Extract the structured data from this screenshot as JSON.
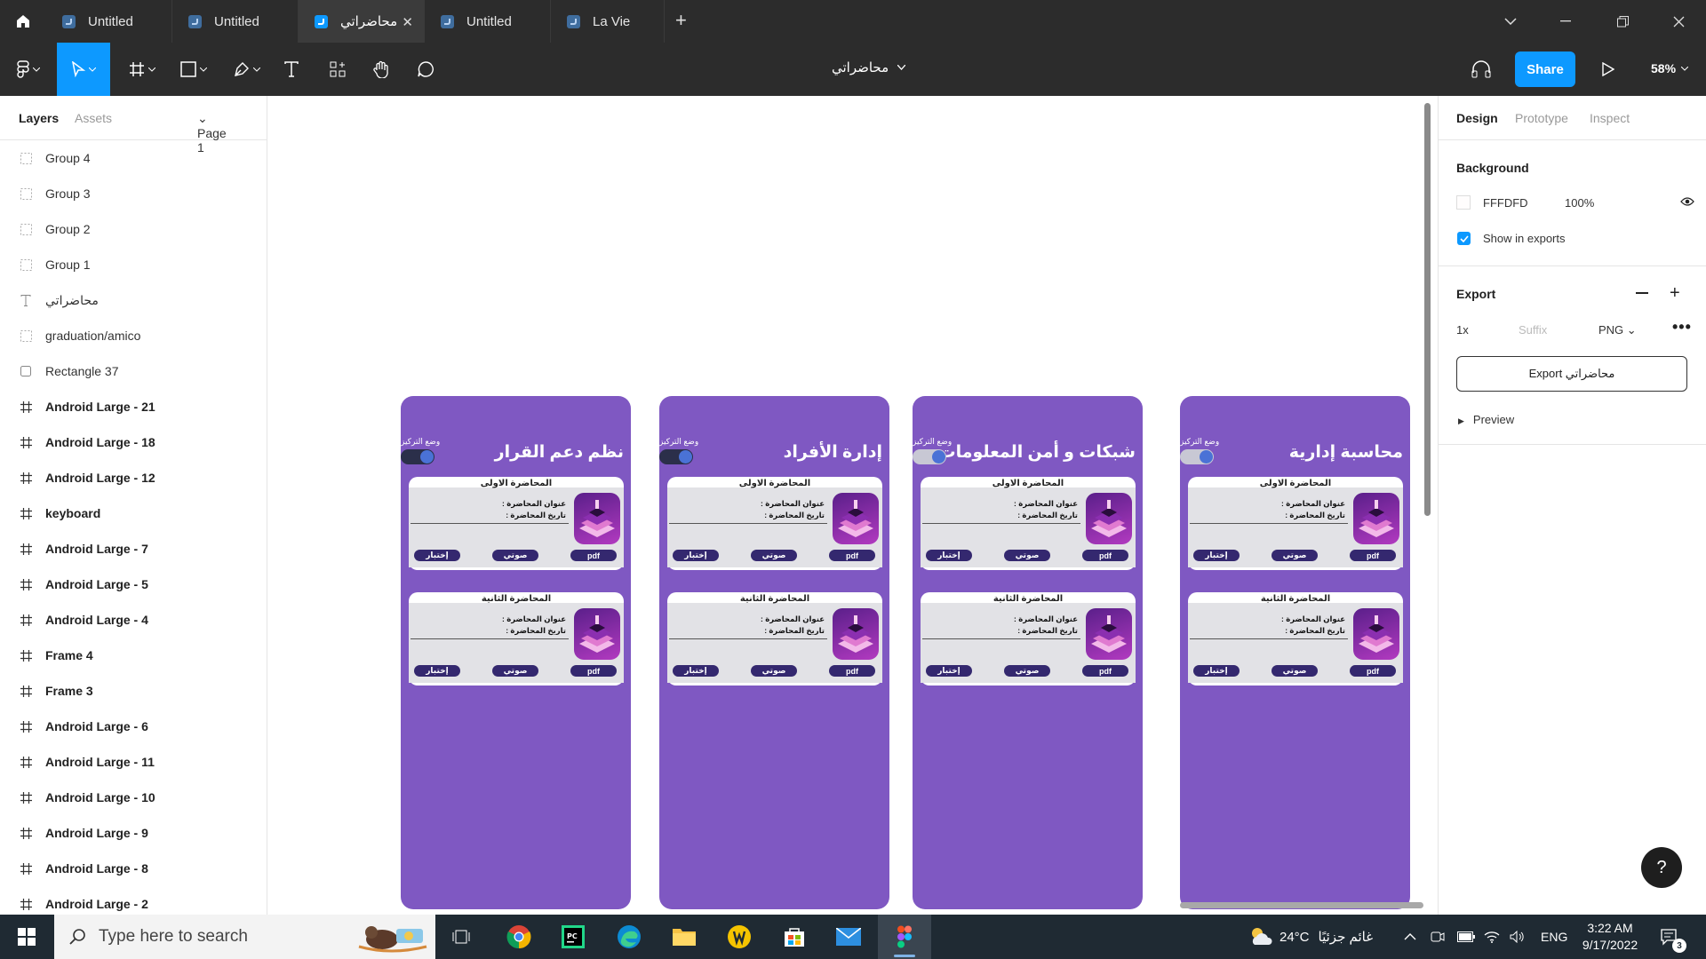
{
  "titlebar": {
    "tabs": [
      {
        "label": "Untitled",
        "active": false
      },
      {
        "label": "Untitled",
        "active": false
      },
      {
        "label": "محاضراتي",
        "active": true
      },
      {
        "label": "Untitled",
        "active": false
      },
      {
        "label": "La Vie",
        "active": false
      }
    ]
  },
  "toolbar": {
    "file_name": "محاضراتي",
    "share_label": "Share",
    "zoom": "58%"
  },
  "left_panel": {
    "tabs": {
      "layers": "Layers",
      "assets": "Assets",
      "page": "Page 1"
    },
    "layers": [
      {
        "name": "Group 4",
        "kind": "group"
      },
      {
        "name": "Group 3",
        "kind": "group"
      },
      {
        "name": "Group 2",
        "kind": "group"
      },
      {
        "name": "Group 1",
        "kind": "group"
      },
      {
        "name": "محاضراتي",
        "kind": "text"
      },
      {
        "name": "graduation/amico",
        "kind": "group"
      },
      {
        "name": "Rectangle 37",
        "kind": "rect"
      },
      {
        "name": "Android Large - 21",
        "kind": "frame"
      },
      {
        "name": "Android Large - 18",
        "kind": "frame"
      },
      {
        "name": "Android Large - 12",
        "kind": "frame"
      },
      {
        "name": "keyboard",
        "kind": "frame"
      },
      {
        "name": "Android Large - 7",
        "kind": "frame"
      },
      {
        "name": "Android Large - 5",
        "kind": "frame"
      },
      {
        "name": "Android Large - 4",
        "kind": "frame"
      },
      {
        "name": "Frame 4",
        "kind": "frame"
      },
      {
        "name": "Frame 3",
        "kind": "frame"
      },
      {
        "name": "Android Large - 6",
        "kind": "frame"
      },
      {
        "name": "Android Large - 11",
        "kind": "frame"
      },
      {
        "name": "Android Large - 10",
        "kind": "frame"
      },
      {
        "name": "Android Large - 9",
        "kind": "frame"
      },
      {
        "name": "Android Large - 8",
        "kind": "frame"
      },
      {
        "name": "Android Large - 2",
        "kind": "frame"
      }
    ]
  },
  "canvas": {
    "focus_label": "وضع التركيز",
    "phones": [
      {
        "title": "نظم دعم القرار",
        "toggle_on": false
      },
      {
        "title": "إدارة الأفراد",
        "toggle_on": false
      },
      {
        "title": "شبكات و أمن المعلومات",
        "toggle_on": true
      },
      {
        "title": "محاسبة إدارية",
        "toggle_on": true
      }
    ],
    "cards": [
      {
        "title": "المحاضرة الاولى"
      },
      {
        "title": "المحاضرة الثانية"
      }
    ],
    "card_line1": "عنوان المحاضرة :",
    "card_line2": "تاريخ المحاضرة :",
    "btn_quiz": "إختبار",
    "btn_audio": "صوتي",
    "btn_pdf": "pdf",
    "colors": {
      "phone_bg": "#7f58c2",
      "button": "#34286f"
    }
  },
  "right_panel": {
    "tabs": {
      "design": "Design",
      "prototype": "Prototype",
      "inspect": "Inspect"
    },
    "background": {
      "title": "Background",
      "hex": "FFFDFD",
      "opacity": "100%",
      "show_in_exports": "Show in exports",
      "checked": true
    },
    "export": {
      "title": "Export",
      "scale": "1x",
      "suffix_placeholder": "Suffix",
      "format": "PNG",
      "button": "Export محاضراتي"
    },
    "preview": "Preview"
  },
  "taskbar": {
    "search_placeholder": "Type here to search",
    "weather_temp": "24°C",
    "weather_text": "غائم جزئيًا",
    "lang": "ENG",
    "time": "3:22 AM",
    "date": "9/17/2022",
    "notifications": "3"
  }
}
